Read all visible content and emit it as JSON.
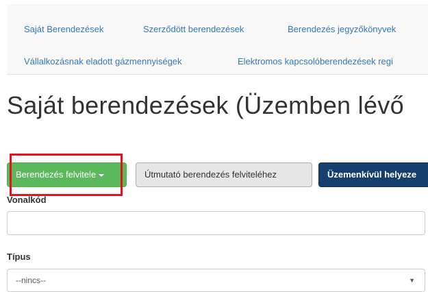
{
  "nav": {
    "items": [
      {
        "label": "Saját Berendezések"
      },
      {
        "label": "Szerződött berendezések"
      },
      {
        "label": "Berendezés jegyzőkönyvek"
      },
      {
        "label": "Vállalkozásnak eladott gázmennyiségek"
      },
      {
        "label": "Elektromos kapcsolóberendezések regi"
      }
    ]
  },
  "page": {
    "title": "Saját berendezések (Üzemben lévő"
  },
  "toolbar": {
    "add_label": "Berendezés felvitele",
    "guide_label": "Útmutató berendezés felviteléhez",
    "out_of_service_label": "Üzemenkívül helyeze"
  },
  "form": {
    "barcode_label": "Vonalkód",
    "barcode_value": "",
    "type_label": "Típus",
    "type_selected": "--nincs--"
  },
  "colors": {
    "success": "#5cb85c",
    "primary": "#173f6e",
    "link": "#337ab7",
    "highlight": "#e8101b"
  }
}
